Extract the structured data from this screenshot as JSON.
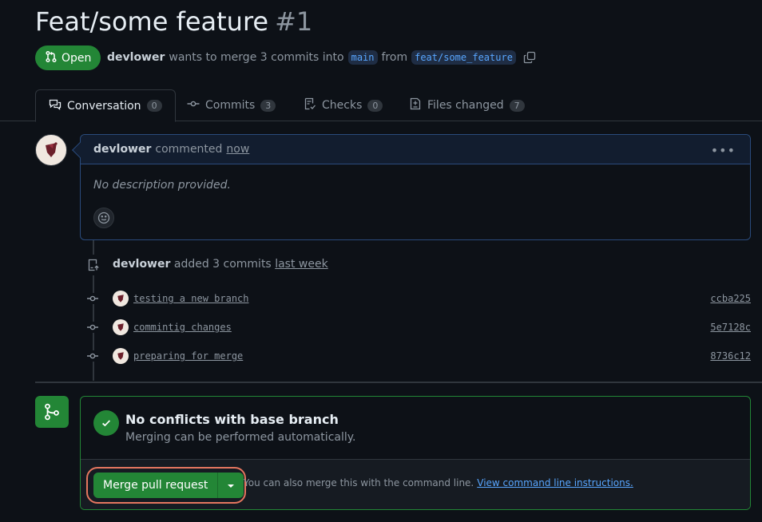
{
  "pr": {
    "title": "Feat/some feature",
    "number": "#1",
    "state": "Open",
    "author": "devlower",
    "merge_text": "wants to merge 3 commits into",
    "base_branch": "main",
    "from_text": "from",
    "head_branch": "feat/some_feature"
  },
  "tabs": [
    {
      "label": "Conversation",
      "count": "0"
    },
    {
      "label": "Commits",
      "count": "3"
    },
    {
      "label": "Checks",
      "count": "0"
    },
    {
      "label": "Files changed",
      "count": "7"
    }
  ],
  "comment": {
    "author": "devlower",
    "action": "commented",
    "time": "now",
    "body": "No description provided."
  },
  "push_event": {
    "author": "devlower",
    "action": "added 3 commits",
    "time": "last week"
  },
  "commits": [
    {
      "message": "testing a new branch",
      "sha": "ccba225"
    },
    {
      "message": "commintig changes",
      "sha": "5e7128c"
    },
    {
      "message": "preparing for merge",
      "sha": "8736c12"
    }
  ],
  "merge": {
    "title": "No conflicts with base branch",
    "subtitle": "Merging can be performed automatically.",
    "button": "Merge pull request",
    "hint": "You can also merge this with the command line.",
    "hint_link": "View command line instructions."
  },
  "colors": {
    "accent_green": "#238636",
    "link_blue": "#58a6ff",
    "highlight": "#e5765f"
  }
}
